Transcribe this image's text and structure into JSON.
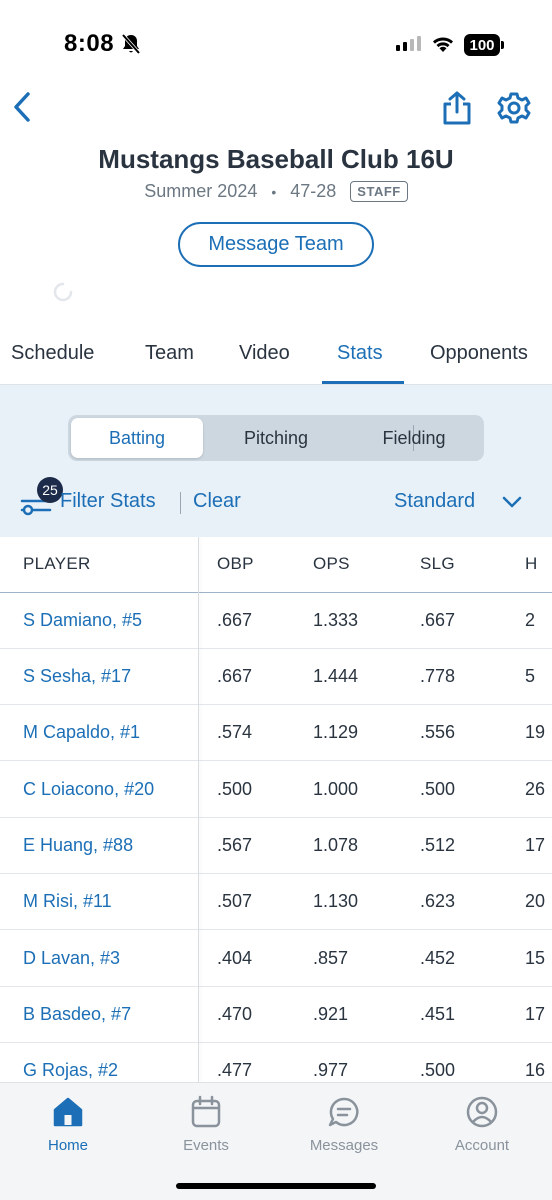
{
  "status_bar": {
    "time": "8:08",
    "battery": "100"
  },
  "header": {
    "title": "Mustangs Baseball Club 16U",
    "season": "Summer 2024",
    "record": "47-28",
    "badge": "STAFF",
    "message_button": "Message Team"
  },
  "tabs": [
    {
      "label": "Schedule",
      "active": false
    },
    {
      "label": "Team",
      "active": false
    },
    {
      "label": "Video",
      "active": false
    },
    {
      "label": "Stats",
      "active": true
    },
    {
      "label": "Opponents",
      "active": false
    }
  ],
  "segments": [
    {
      "label": "Batting",
      "active": true
    },
    {
      "label": "Pitching",
      "active": false
    },
    {
      "label": "Fielding",
      "active": false
    }
  ],
  "filters": {
    "badge_count": "25",
    "filter_label": "Filter Stats",
    "clear_label": "Clear",
    "view_select": "Standard"
  },
  "table": {
    "columns": [
      "PLAYER",
      "OBP",
      "OPS",
      "SLG",
      "H"
    ],
    "rows": [
      [
        "S Damiano, #5",
        ".667",
        "1.333",
        ".667",
        "2"
      ],
      [
        "S Sesha, #17",
        ".667",
        "1.444",
        ".778",
        "5"
      ],
      [
        "M Capaldo, #1",
        ".574",
        "1.129",
        ".556",
        "19"
      ],
      [
        "C Loiacono, #20",
        ".500",
        "1.000",
        ".500",
        "26"
      ],
      [
        "E Huang, #88",
        ".567",
        "1.078",
        ".512",
        "17"
      ],
      [
        "M Risi, #11",
        ".507",
        "1.130",
        ".623",
        "20"
      ],
      [
        "D Lavan, #3",
        ".404",
        ".857",
        ".452",
        "15"
      ],
      [
        "B Basdeo, #7",
        ".470",
        ".921",
        ".451",
        "17"
      ],
      [
        "G Rojas, #2",
        ".477",
        ".977",
        ".500",
        "16"
      ]
    ]
  },
  "bottom_nav": [
    {
      "label": "Home",
      "icon": "home-icon",
      "active": true
    },
    {
      "label": "Events",
      "icon": "calendar-icon",
      "active": false
    },
    {
      "label": "Messages",
      "icon": "message-icon",
      "active": false
    },
    {
      "label": "Account",
      "icon": "account-icon",
      "active": false
    }
  ],
  "colors": {
    "accent": "#1c6fb6",
    "panel": "#e8f0f8",
    "text": "#2a3440",
    "muted": "#6b7782"
  }
}
